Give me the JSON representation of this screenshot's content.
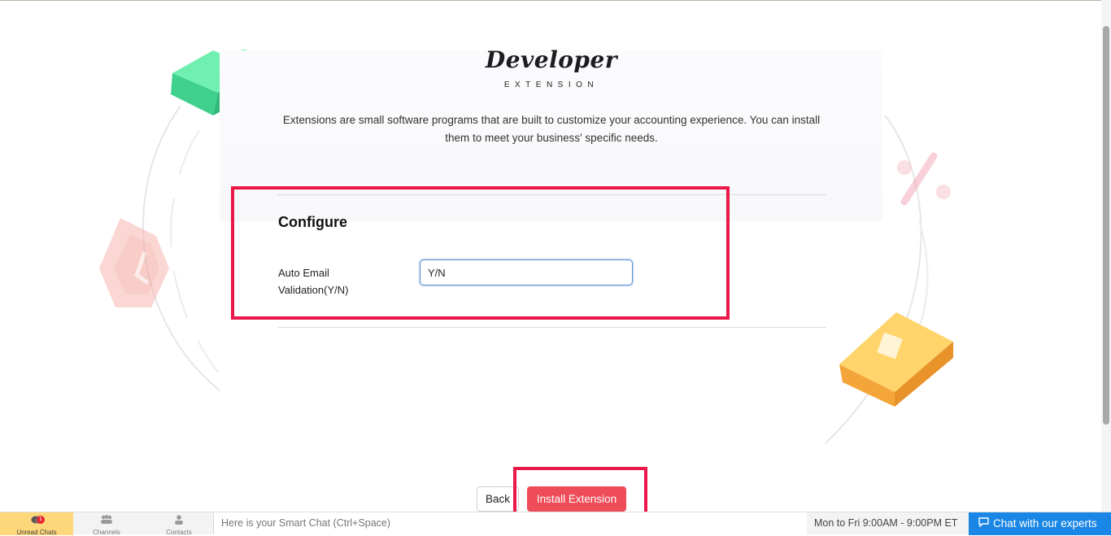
{
  "header": {
    "title": "Developer",
    "subtitle": "EXTENSION",
    "description": "Extensions are small software programs that are built to customize your accounting experience. You can install them to meet your business' specific needs."
  },
  "configure": {
    "heading": "Configure",
    "fields": [
      {
        "label": "Auto Email Validation(Y/N)",
        "value": "Y/N"
      }
    ]
  },
  "actions": {
    "back_label": "Back",
    "install_label": "Install Extension"
  },
  "bottom_bar": {
    "tabs": [
      {
        "label": "Unread Chats",
        "icon": "chat-bubbles-icon",
        "badge": "1",
        "active": true
      },
      {
        "label": "Channels",
        "icon": "users-group-icon",
        "active": false
      },
      {
        "label": "Contacts",
        "icon": "person-icon",
        "active": false
      }
    ],
    "smart_chat_placeholder": "Here is your Smart Chat (Ctrl+Space)",
    "hours": "Mon to Fri 9:00AM - 9:00PM ET",
    "chat_button_label": "Chat with our experts"
  },
  "colors": {
    "highlight": "#ea1848",
    "install_button": "#ee4c58",
    "input_border": "#4f86ce",
    "chat_button": "#1a86e5",
    "active_tab": "#fdd77a"
  }
}
